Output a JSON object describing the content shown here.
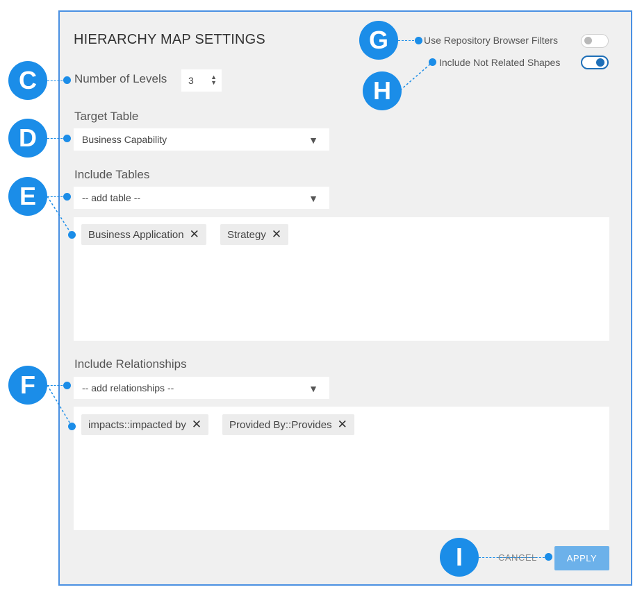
{
  "dialog": {
    "title": "HIERARCHY MAP SETTINGS",
    "cancel_label": "CANCEL",
    "apply_label": "APPLY"
  },
  "levels": {
    "label": "Number of Levels",
    "value": "3",
    "spinner_icon": "up-down-arrows"
  },
  "target_table": {
    "label": "Target Table",
    "selected": "Business Capability"
  },
  "include_tables": {
    "label": "Include Tables",
    "placeholder": "-- add table --",
    "tags": [
      "Business Application",
      "Strategy"
    ]
  },
  "include_relationships": {
    "label": "Include Relationships",
    "placeholder": "-- add relationships --",
    "tags": [
      "impacts::impacted by",
      "Provided By::Provides"
    ]
  },
  "toggles": {
    "repo_filters": {
      "label": "Use Repository Browser Filters",
      "state": "off"
    },
    "not_related": {
      "label": "Include Not Related Shapes",
      "state": "on"
    }
  },
  "callouts": [
    "C",
    "D",
    "E",
    "F",
    "G",
    "H",
    "I"
  ],
  "colors": {
    "accent": "#1b8de8",
    "panel_border": "#4a90e2",
    "apply_button": "#6cb1ea",
    "toggle_on": "#1e6fb8"
  }
}
